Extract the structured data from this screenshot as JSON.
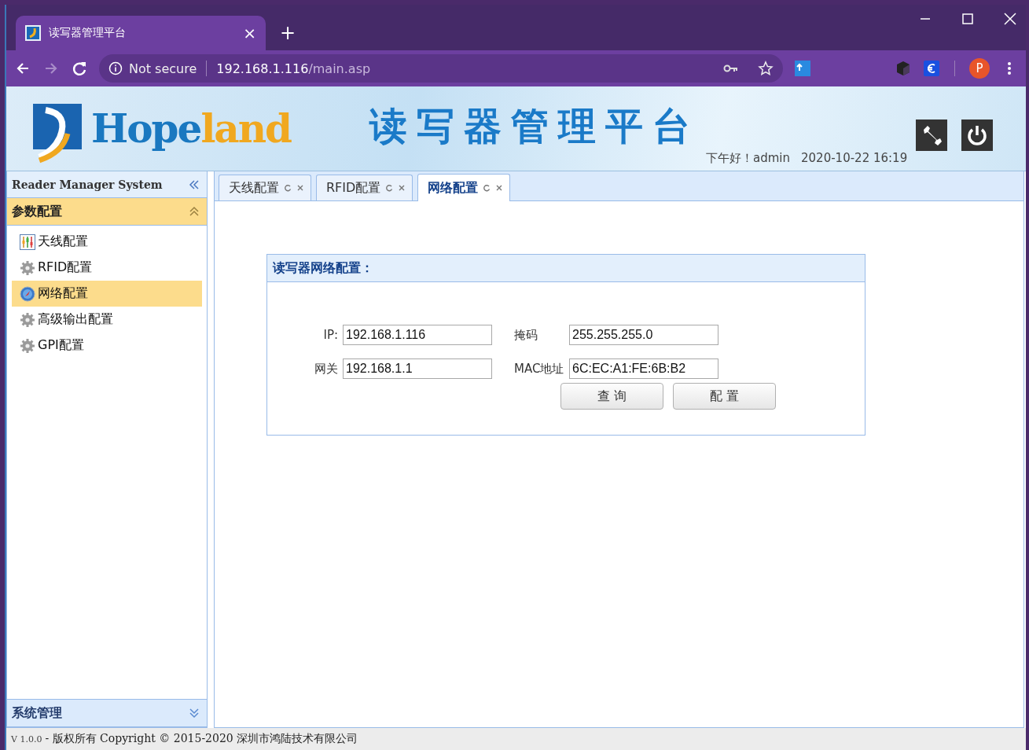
{
  "browser": {
    "tab_title": "读写器管理平台",
    "tab_close": "×",
    "new_tab": "+",
    "security": "Not secure",
    "url_host": "192.168.1.116",
    "url_path": "/main.asp",
    "avatar": "P"
  },
  "header": {
    "logo_first": "Hope",
    "logo_second": "land",
    "title": "读写器管理平台",
    "greeting": "下午好！admin",
    "datetime": "2020-10-22 16:19"
  },
  "sidebar": {
    "title": "Reader Manager System",
    "groups": [
      {
        "label": "参数配置",
        "expanded": true,
        "items": [
          {
            "label": "天线配置",
            "kind": "chart",
            "selected": false
          },
          {
            "label": "RFID配置",
            "kind": "gear",
            "selected": false
          },
          {
            "label": "网络配置",
            "kind": "globe",
            "selected": true
          },
          {
            "label": "高级输出配置",
            "kind": "gear",
            "selected": false
          },
          {
            "label": "GPI配置",
            "kind": "gear",
            "selected": false
          }
        ]
      },
      {
        "label": "系统管理",
        "expanded": false
      }
    ]
  },
  "tabs": [
    {
      "label": "天线配置",
      "selected": false
    },
    {
      "label": "RFID配置",
      "selected": false
    },
    {
      "label": "网络配置",
      "selected": true
    }
  ],
  "panel": {
    "title": "读写器网络配置：",
    "fields": [
      {
        "label": "IP:",
        "value": "192.168.1.116"
      },
      {
        "label": "掩码",
        "value": "255.255.255.0"
      },
      {
        "label": "网关",
        "value": "192.168.1.1"
      },
      {
        "label": "MAC地址",
        "value": "6C:EC:A1:FE:6B:B2"
      }
    ],
    "buttons": [
      "查 询",
      "配 置"
    ]
  },
  "footer": {
    "version": "V 1.0.0",
    "text": "- 版权所有 Copyright © 2015-2020 深圳市鸿陆技术有限公司"
  }
}
